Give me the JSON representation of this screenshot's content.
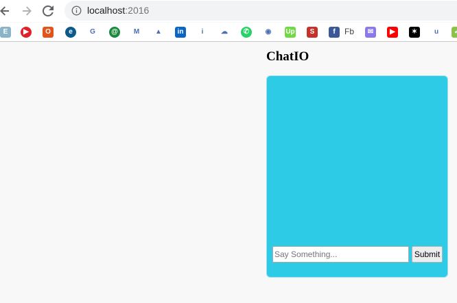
{
  "browser": {
    "url_host": "localhost",
    "url_port": ":2016",
    "bookmarks": [
      {
        "name": "bookmark-e-icon",
        "label": "E",
        "color": "#8ab4c8"
      },
      {
        "name": "bookmark-play-icon",
        "label": "▶",
        "color": "#e0212a"
      },
      {
        "name": "bookmark-office-icon",
        "label": "O",
        "color": "#e3541c"
      },
      {
        "name": "bookmark-e2-icon",
        "label": "e",
        "color": "#0b5a8c"
      },
      {
        "name": "bookmark-google-icon",
        "label": "G",
        "color": "#ffffff"
      },
      {
        "name": "bookmark-swirl-icon",
        "label": "@",
        "color": "#1a8a3a"
      },
      {
        "name": "bookmark-gmail-icon",
        "label": "M",
        "color": "#ffffff"
      },
      {
        "name": "bookmark-drive-icon",
        "label": "▲",
        "color": "#ffffff"
      },
      {
        "name": "bookmark-linkedin-icon",
        "label": "in",
        "color": "#0a66c2"
      },
      {
        "name": "bookmark-info-icon",
        "label": "i",
        "color": "#ffffff"
      },
      {
        "name": "bookmark-onedrive-icon",
        "label": "☁",
        "color": "#ffffff"
      },
      {
        "name": "bookmark-whatsapp-icon",
        "label": "✆",
        "color": "#25d366"
      },
      {
        "name": "bookmark-github-icon",
        "label": "◉",
        "color": "#ffffff"
      },
      {
        "name": "bookmark-upwork-icon",
        "label": "Up",
        "color": "#6fda44"
      },
      {
        "name": "bookmark-s-icon",
        "label": "S",
        "color": "#c8302a"
      },
      {
        "name": "bookmark-facebook-icon",
        "label": "f",
        "color": "#3b5998"
      },
      {
        "name": "bookmark-mail-icon",
        "label": "✉",
        "color": "#8a7ae8"
      },
      {
        "name": "bookmark-youtube-icon",
        "label": "▶",
        "color": "#ff0000"
      },
      {
        "name": "bookmark-star-icon",
        "label": "✶",
        "color": "#000000"
      },
      {
        "name": "bookmark-u-icon",
        "label": "u",
        "color": "#ffffff"
      },
      {
        "name": "bookmark-check-icon",
        "label": "✓",
        "color": "#8bc34a"
      }
    ],
    "fb_label": "Fb"
  },
  "app": {
    "title": "ChatIO",
    "input_placeholder": "Say Something...",
    "submit_label": "Submit",
    "chat_bg": "#2ecbe6"
  }
}
